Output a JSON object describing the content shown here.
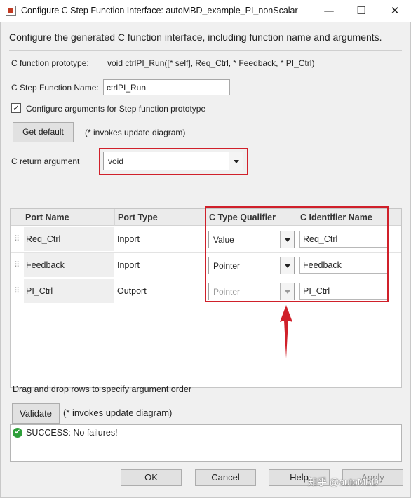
{
  "window": {
    "title": "Configure C Step Function Interface: autoMBD_example_PI_nonScalar",
    "minimize_glyph": "—",
    "maximize_glyph": "☐",
    "close_glyph": "✕"
  },
  "description": "Configure the generated C function interface, including function name and arguments.",
  "prototype": {
    "label": "C function prototype:",
    "value": "void ctrlPI_Run([* self], Req_Ctrl, * Feedback, * PI_Ctrl)"
  },
  "step_function_name": {
    "label": "C Step Function Name:",
    "value": "ctrlPI_Run"
  },
  "configure_args": {
    "checked": true,
    "check_glyph": "✓",
    "label": "Configure arguments for Step function prototype"
  },
  "get_default": {
    "button_label": "Get default",
    "note": "(* invokes update diagram)"
  },
  "return_argument": {
    "label": "C return argument",
    "value": "void"
  },
  "table": {
    "handle_glyph": "⠿",
    "columns": [
      "Port Name",
      "Port Type",
      "C Type Qualifier",
      "C Identifier Name"
    ],
    "rows": [
      {
        "port_name": "Req_Ctrl",
        "port_type": "Inport",
        "qualifier": "Value",
        "identifier": "Req_Ctrl",
        "qualifier_enabled": true
      },
      {
        "port_name": "Feedback",
        "port_type": "Inport",
        "qualifier": "Pointer",
        "identifier": "Feedback",
        "qualifier_enabled": true
      },
      {
        "port_name": "PI_Ctrl",
        "port_type": "Outport",
        "qualifier": "Pointer",
        "identifier": "PI_Ctrl",
        "qualifier_enabled": false
      }
    ]
  },
  "drag_hint": "Drag and drop rows to specify argument order",
  "validate": {
    "button_label": "Validate",
    "note": "(* invokes update diagram)"
  },
  "status": {
    "icon_glyph": "✔",
    "text": "SUCCESS: No failures!"
  },
  "footer": {
    "ok_label": "OK",
    "cancel_label": "Cancel",
    "help_label": "Help",
    "apply_label": "Apply"
  },
  "watermark": "知乎 @autoMBD",
  "colors": {
    "highlight_red": "#d0202a",
    "success_green": "#2e9f3a"
  },
  "icons": [
    "app-icon",
    "minimize-icon",
    "maximize-icon",
    "close-icon",
    "checkmark-icon",
    "drag-handle-icon",
    "chevron-down-icon",
    "success-icon",
    "red-arrow-annotation"
  ]
}
